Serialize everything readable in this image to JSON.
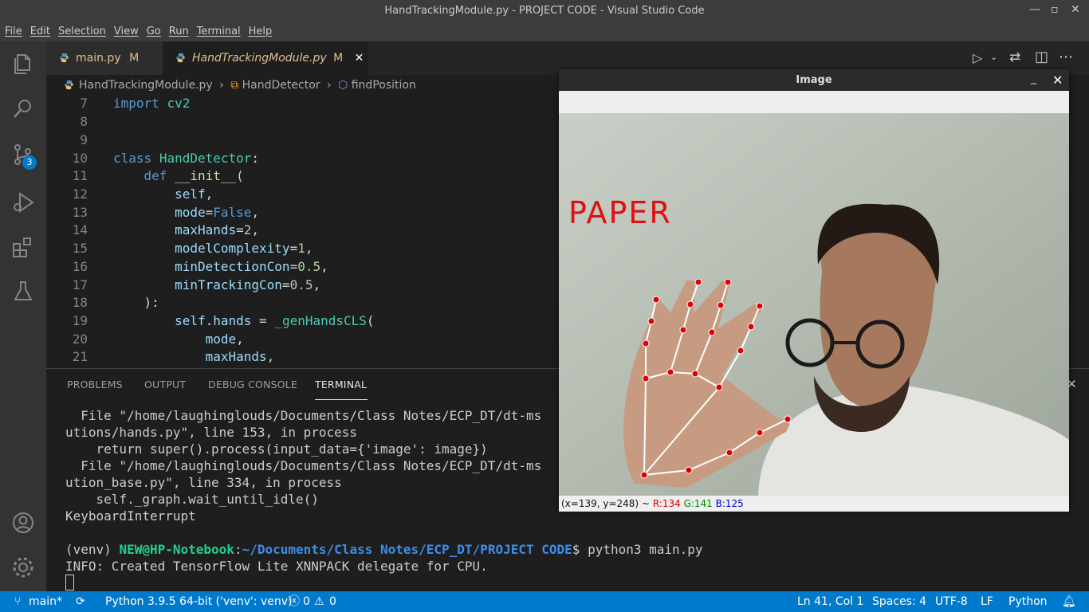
{
  "window": {
    "title": "HandTrackingModule.py - PROJECT CODE - Visual Studio Code"
  },
  "menu": [
    "File",
    "Edit",
    "Selection",
    "View",
    "Go",
    "Run",
    "Terminal",
    "Help"
  ],
  "activity": {
    "scm_badge": "3"
  },
  "tabs": [
    {
      "label": "main.py",
      "status": "M"
    },
    {
      "label": "HandTrackingModule.py",
      "status": "M"
    }
  ],
  "breadcrumbs": [
    "HandTrackingModule.py",
    "HandDetector",
    "findPosition"
  ],
  "editor": {
    "line_numbers": [
      "7",
      "8",
      "9",
      "10",
      "11",
      "12",
      "13",
      "14",
      "15",
      "16",
      "17",
      "18",
      "19",
      "20",
      "21"
    ]
  },
  "panel": {
    "tabs": [
      "PROBLEMS",
      "OUTPUT",
      "DEBUG CONSOLE",
      "TERMINAL"
    ],
    "active_tab": "TERMINAL",
    "terminal": {
      "line1": "  File \"/home/laughinglouds/Documents/Class Notes/ECP_DT/dt-ms",
      "line2": "utions/hands.py\", line 153, in process",
      "line3": "    return super().process(input_data={'image': image})",
      "line4": "  File \"/home/laughinglouds/Documents/Class Notes/ECP_DT/dt-ms",
      "line5": "ution_base.py\", line 334, in process",
      "line6": "    self._graph.wait_until_idle()",
      "line7": "KeyboardInterrupt",
      "prompt_venv": "(venv) ",
      "prompt_user": "NEW@HP-Notebook",
      "prompt_path": "~/Documents/Class Notes/ECP_DT/PROJECT CODE",
      "prompt_cmd": "$ python3 main.py",
      "line9": "INFO: Created TensorFlow Lite XNNPACK delegate for CPU."
    }
  },
  "status": {
    "branch": "main*",
    "interpreter": "Python 3.9.5 64-bit ('venv': venv)",
    "errors": "0",
    "warnings": "0",
    "position": "Ln 41, Col 1",
    "spaces": "Spaces: 4",
    "encoding": "UTF-8",
    "eol": "LF",
    "language": "Python"
  },
  "image_window": {
    "title": "Image",
    "overlay_text": "PAPER",
    "pixel_coords": "(x=139, y=248) ~",
    "r": "R:134",
    "g": "G:141",
    "b": "B:125"
  },
  "colors": {
    "accent": "#007acc",
    "modified": "#e2c08d",
    "overlay_text": "#e01010",
    "landmark": "#e00000"
  },
  "icons": [
    "explorer-icon",
    "search-icon",
    "source-control-icon",
    "run-debug-icon",
    "extensions-icon",
    "testing-icon",
    "account-icon",
    "settings-gear-icon",
    "python-file-icon",
    "run-icon",
    "split-editor-icon",
    "more-actions-icon"
  ]
}
